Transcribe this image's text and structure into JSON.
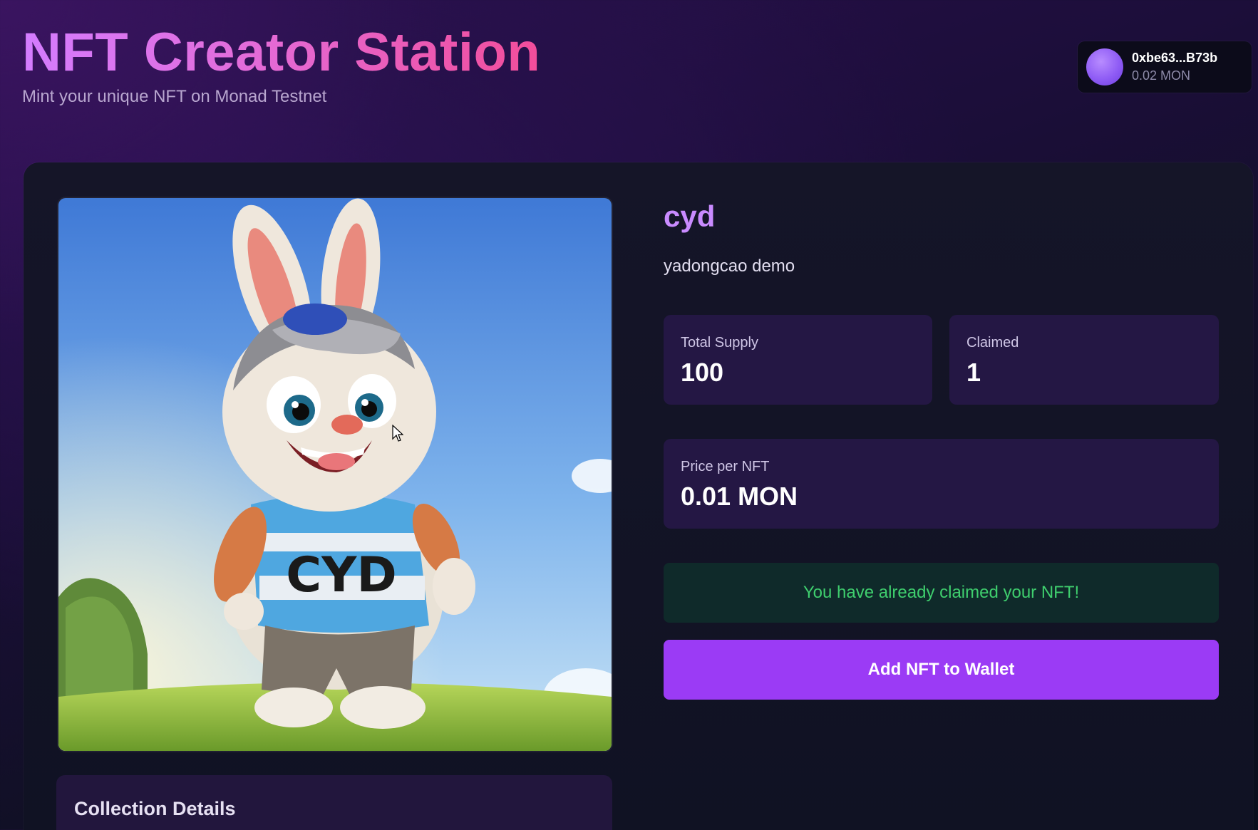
{
  "header": {
    "title": "NFT Creator Station",
    "subtitle": "Mint your unique NFT on Monad Testnet"
  },
  "wallet": {
    "address": "0xbe63...B73b",
    "balance": "0.02 MON"
  },
  "nft": {
    "name": "cyd",
    "description": "yadongcao demo",
    "image_shirt_text": "CYD"
  },
  "stats": {
    "total_supply_label": "Total Supply",
    "total_supply_value": "100",
    "claimed_label": "Claimed",
    "claimed_value": "1",
    "price_label": "Price per NFT",
    "price_value": "0.01 MON"
  },
  "status": {
    "claimed_message": "You have already claimed your NFT!"
  },
  "actions": {
    "add_to_wallet_label": "Add NFT to Wallet"
  },
  "collection": {
    "title": "Collection Details"
  },
  "colors": {
    "accent_purple": "#9b3bf5",
    "name_purple": "#c98bff",
    "success_green": "#3fcf6e"
  }
}
